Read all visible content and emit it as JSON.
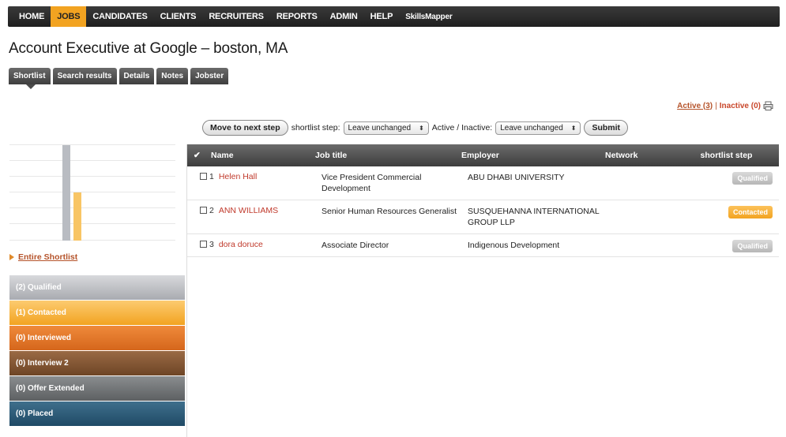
{
  "nav": {
    "items": [
      {
        "label": "HOME",
        "active": false
      },
      {
        "label": "JOBS",
        "active": true
      },
      {
        "label": "CANDIDATES",
        "active": false
      },
      {
        "label": "CLIENTS",
        "active": false
      },
      {
        "label": "RECRUITERS",
        "active": false
      },
      {
        "label": "REPORTS",
        "active": false
      },
      {
        "label": "ADMIN",
        "active": false
      },
      {
        "label": "HELP",
        "active": false
      },
      {
        "label": "SkillsMapper",
        "active": false
      }
    ]
  },
  "page": {
    "title": "Account Executive at Google – boston, MA"
  },
  "subtabs": [
    "Shortlist",
    "Search results",
    "Details",
    "Notes",
    "Jobster"
  ],
  "status_links": {
    "active": "Active (3)",
    "separator": "|",
    "inactive": "Inactive (0)",
    "icon": "print-icon"
  },
  "toolbar": {
    "move_button": "Move to next step",
    "shortlist_step_label": "shortlist step:",
    "shortlist_step_value": "Leave unchanged",
    "active_inactive_label": "Active / Inactive:",
    "active_inactive_value": "Leave unchanged",
    "submit_button": "Submit"
  },
  "sidebar": {
    "entire_shortlist": "Entire Shortlist",
    "chart": {
      "bars": [
        {
          "name": "qualified",
          "value": 2,
          "color": "#b9bcc2"
        },
        {
          "name": "contacted",
          "value": 1,
          "color": "#f8c565"
        }
      ],
      "max": 2
    },
    "steps": [
      {
        "label": "(2) Qualified",
        "color_top": "#d8d9dc",
        "color_bottom": "#a9abb0"
      },
      {
        "label": "(1) Contacted",
        "color_top": "#fccb70",
        "color_bottom": "#f2a321"
      },
      {
        "label": "(0) Interviewed",
        "color_top": "#ef8a3a",
        "color_bottom": "#d5661c"
      },
      {
        "label": "(0) Interview 2",
        "color_top": "#9a6a44",
        "color_bottom": "#6e4526"
      },
      {
        "label": "(0) Offer Extended",
        "color_top": "#8a8d8f",
        "color_bottom": "#5d6062"
      },
      {
        "label": "(0) Placed",
        "color_top": "#3f6f8c",
        "color_bottom": "#1f4a66"
      }
    ]
  },
  "table": {
    "headers": {
      "check": "✔",
      "name": "Name",
      "job": "Job title",
      "employer": "Employer",
      "network": "Network",
      "step": "shortlist step"
    },
    "rows": [
      {
        "num": "1",
        "name": "Helen Hall",
        "job": "Vice President Commercial Development",
        "employer": "ABU DHABI UNIVERSITY",
        "network": "",
        "step": "Qualified",
        "step_class": "qualified"
      },
      {
        "num": "2",
        "name": "ANN WILLIAMS",
        "job": "Senior Human Resources Generalist",
        "employer": "SUSQUEHANNA INTERNATIONAL GROUP LLP",
        "network": "",
        "step": "Contacted",
        "step_class": "contacted"
      },
      {
        "num": "3",
        "name": "dora doruce",
        "job": "Associate Director",
        "employer": "Indigenous Development",
        "network": "",
        "step": "Qualified",
        "step_class": "qualified"
      }
    ]
  }
}
